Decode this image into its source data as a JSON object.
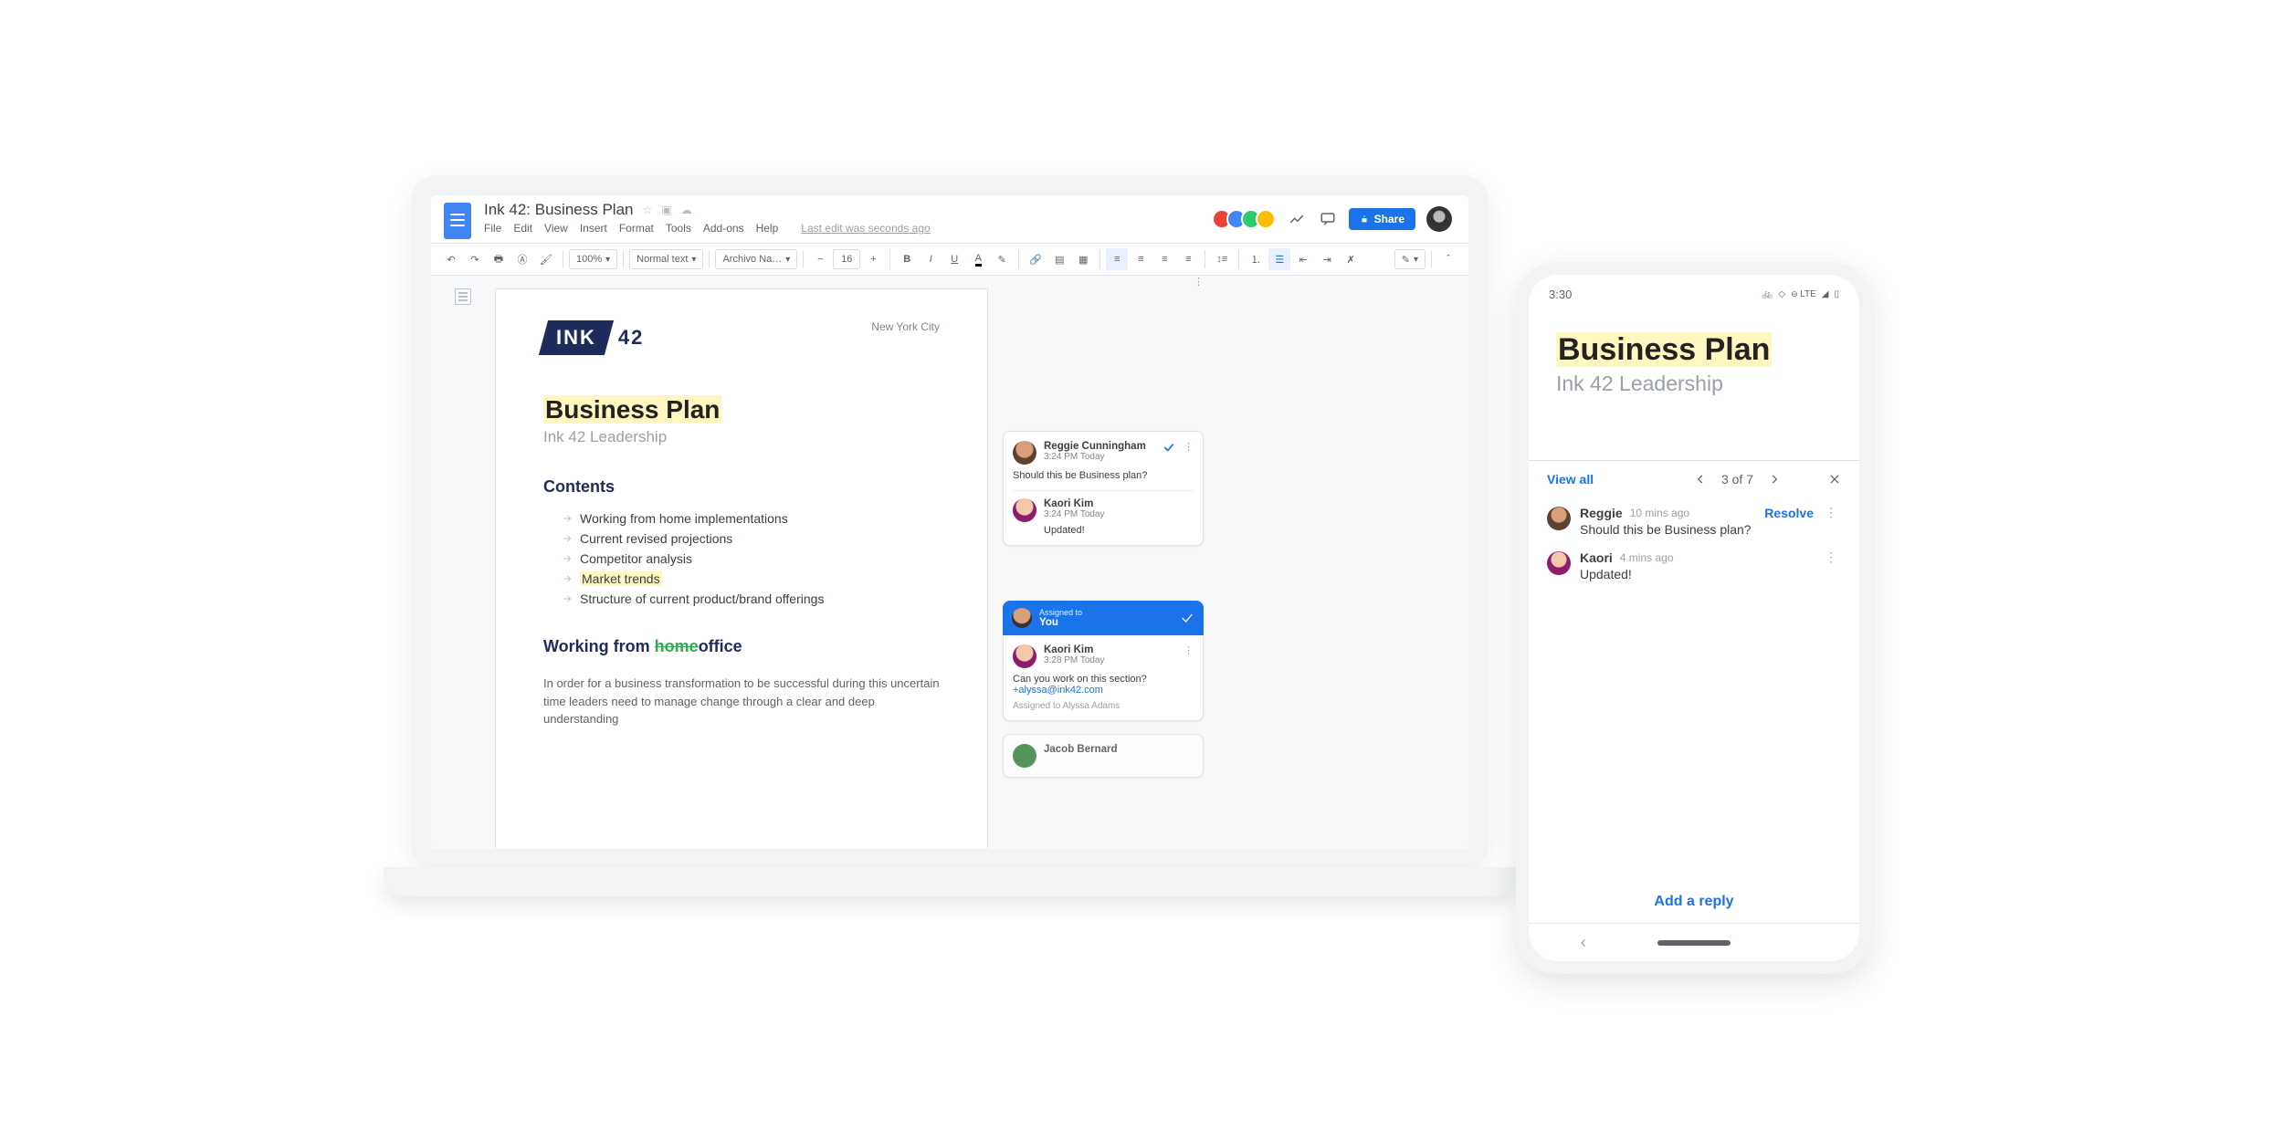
{
  "colors": {
    "accent": "#1a73e8",
    "highlight": "#fff6c0",
    "brand_navy": "#1f2b5b",
    "green": "#34a853"
  },
  "header": {
    "doc_title": "Ink 42: Business Plan",
    "menu": [
      "File",
      "Edit",
      "View",
      "Insert",
      "Format",
      "Tools",
      "Add-ons",
      "Help"
    ],
    "last_edit": "Last edit was seconds ago",
    "share": "Share"
  },
  "toolbar": {
    "zoom": "100%",
    "style": "Normal text",
    "font": "Archivo Na…",
    "size": "16"
  },
  "document": {
    "logo_ink": "INK",
    "logo_42": "42",
    "city": "New York City",
    "h1": "Business Plan",
    "subtitle": "Ink 42 Leadership",
    "contents_heading": "Contents",
    "contents": [
      {
        "text": "Working from home implementations",
        "highlight": false
      },
      {
        "text": "Current revised projections",
        "highlight": false
      },
      {
        "text": "Competitor analysis",
        "highlight": false
      },
      {
        "text": "Market trends",
        "highlight": true
      },
      {
        "text": "Structure of current product/brand offerings",
        "highlight": false
      }
    ],
    "section_heading_pre": "Working from ",
    "section_heading_strike": "home",
    "section_heading_post": "office",
    "para1": "In order for a business transformation to be successful during this uncertain",
    "para2": "time leaders need to manage change through a clear and deep understanding"
  },
  "comments_desktop": {
    "card1": {
      "author": "Reggie Cunningham",
      "time": "3:24 PM Today",
      "text": "Should this be Business plan?",
      "reply_author": "Kaori Kim",
      "reply_time": "3:24 PM Today",
      "reply_text": "Updated!"
    },
    "card2": {
      "assigned_label": "Assigned to",
      "assigned_to": "You",
      "author": "Kaori Kim",
      "time": "3:28 PM Today",
      "text": "Can you work on this section?",
      "mention": "+alyssa@ink42.com",
      "note": "Assigned to Alyssa Adams"
    },
    "card3": {
      "author": "Jacob Bernard"
    }
  },
  "phone": {
    "status_time": "3:30",
    "status_net": "LTE",
    "h1": "Business Plan",
    "subtitle": "Ink 42 Leadership",
    "view_all": "View all",
    "counter": "3 of 7",
    "thread": [
      {
        "name": "Reggie",
        "time": "10 mins ago",
        "text": "Should this be Business plan?",
        "resolve": "Resolve"
      },
      {
        "name": "Kaori",
        "time": "4 mins ago",
        "text": "Updated!"
      }
    ],
    "add_reply": "Add a reply"
  }
}
